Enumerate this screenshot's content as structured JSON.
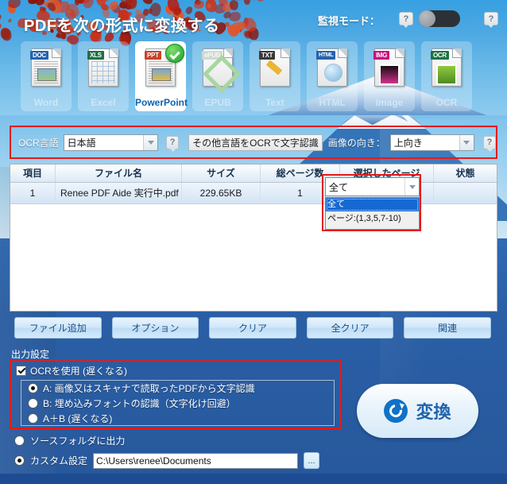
{
  "header": {
    "title": "PDFを次の形式に変換する",
    "watch_mode_label": "監視モード：",
    "help_icon": "?",
    "help_icon2": "?",
    "toggle_state": "off"
  },
  "formats": [
    {
      "label": "Word",
      "badge": "DOC",
      "badge_color": "#2763ae",
      "selected": false
    },
    {
      "label": "Excel",
      "badge": "XLS",
      "badge_color": "#1e7145",
      "selected": false
    },
    {
      "label": "PowerPoint",
      "badge": "PPT",
      "badge_color": "#c8442b",
      "selected": true
    },
    {
      "label": "EPUB",
      "badge": "ePUB",
      "badge_color": "#9bbf96",
      "selected": false
    },
    {
      "label": "Text",
      "badge": "TXT",
      "badge_color": "#3a3a3a",
      "selected": false
    },
    {
      "label": "HTML",
      "badge": "HTML",
      "badge_color": "#2763ae",
      "selected": false
    },
    {
      "label": "Image",
      "badge": "IMG",
      "badge_color": "#c4117f",
      "selected": false
    },
    {
      "label": "OCR",
      "badge": "OCR",
      "badge_color": "#1e7145",
      "selected": false
    }
  ],
  "ocr_bar": {
    "language_label": "OCR言語",
    "language_value": "日本語",
    "help_icon": "?",
    "other_lang_button": "その他言語をOCRで文字認識",
    "orientation_label": "画像の向き：",
    "orientation_value": "上向き",
    "help_icon2": "?"
  },
  "file_table": {
    "columns": [
      "項目",
      "ファイル名",
      "サイズ",
      "総ページ数",
      "選択したページ",
      "状態"
    ],
    "rows": [
      {
        "index": "1",
        "filename": "Renee PDF Aide 実行中.pdf",
        "size": "229.65KB",
        "pages": "1",
        "selected_pages": "全て",
        "status": ""
      }
    ],
    "page_dropdown": {
      "value": "全て",
      "options": [
        "全て",
        "ページ:(1,3,5,7-10)"
      ],
      "selected_index": 0,
      "open": true
    }
  },
  "actions": [
    {
      "label": "ファイル追加"
    },
    {
      "label": "オプション"
    },
    {
      "label": "クリア"
    },
    {
      "label": "全クリア"
    },
    {
      "label": "関連"
    }
  ],
  "output": {
    "section_title": "出力設定",
    "use_ocr_label": "OCRを使用 (遅くなる)",
    "use_ocr_checked": true,
    "modes": [
      {
        "label": "A: 画像又はスキャナで読取ったPDFから文字認識",
        "selected": true
      },
      {
        "label": "B: 埋め込みフォントの認識（文字化け回避）",
        "selected": false
      },
      {
        "label": "A＋B (遅くなる)",
        "selected": false
      }
    ],
    "destinations": [
      {
        "label": "ソースフォルダに出力",
        "selected": false
      },
      {
        "label": "カスタム設定",
        "selected": true
      }
    ],
    "path_value": "C:\\Users\\renee\\Documents",
    "browse_label": "..."
  },
  "convert_button": {
    "label": "変換",
    "icon": "refresh-icon"
  },
  "colors": {
    "accent_red": "#e31b1b",
    "window_blue": "#2a5faa",
    "brand_blue": "#1f63ad"
  }
}
